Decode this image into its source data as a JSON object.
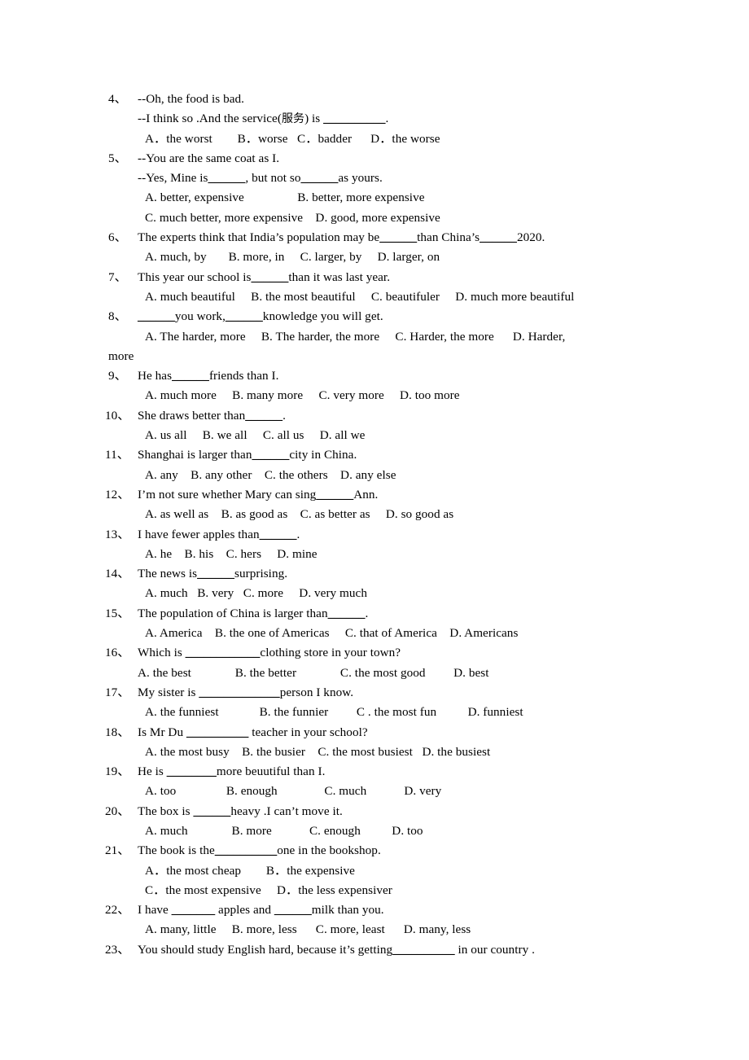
{
  "document": {
    "type": "worksheet",
    "subject": "English grammar multiple-choice exercise (comparatives and superlatives)",
    "background_color": "#ffffff",
    "text_color": "#000000",
    "number_separator": "、"
  },
  "questions": [
    {
      "number": "4",
      "stem": "--Oh, the food is bad.",
      "stem_lines": [
        {
          "segments": [
            {
              "text": "--I think so .And the service("
            },
            {
              "text": "服务",
              "style": "zh"
            },
            {
              "text": ") is "
            },
            {
              "text": "__________",
              "style": "blank"
            },
            {
              "text": "."
            }
          ]
        }
      ],
      "option_rows": [
        {
          "text": "A．the worst        B．worse   C．badder      D．the worse"
        }
      ]
    },
    {
      "number": "5",
      "stem": "--You are the same coat as I.",
      "stem_lines": [
        {
          "segments": [
            {
              "text": "--Yes, Mine is"
            },
            {
              "text": "______",
              "style": "blank"
            },
            {
              "text": ", but not so"
            },
            {
              "text": "______",
              "style": "blank"
            },
            {
              "text": "as yours."
            }
          ]
        }
      ],
      "option_rows": [
        {
          "text": "A. better, expensive                 B. better, more expensive"
        },
        {
          "text": "C. much better, more expensive    D. good, more expensive"
        }
      ]
    },
    {
      "number": "6",
      "stem_segments": [
        {
          "text": "The experts think that India’s population may be"
        },
        {
          "text": "______",
          "style": "blank"
        },
        {
          "text": "than China’s"
        },
        {
          "text": "______",
          "style": "blank"
        },
        {
          "text": "2020."
        }
      ],
      "option_rows": [
        {
          "text": "A. much, by       B. more, in     C. larger, by     D. larger, on"
        }
      ]
    },
    {
      "number": "7",
      "stem_segments": [
        {
          "text": "This year our school is"
        },
        {
          "text": "______",
          "style": "blank"
        },
        {
          "text": "than it was last year."
        }
      ],
      "option_rows": [
        {
          "text": "A. much beautiful     B. the most beautiful     C. beautifuler     D. much more beautiful"
        }
      ]
    },
    {
      "number": "8",
      "stem_segments": [
        {
          "text": "______",
          "style": "blank"
        },
        {
          "text": "you work,"
        },
        {
          "text": "______",
          "style": "blank"
        },
        {
          "text": "knowledge you will get."
        }
      ],
      "option_rows": [
        {
          "text": "A. The harder, more     B. The harder, the more     C. Harder, the more      D. Harder,"
        },
        {
          "text": "more",
          "wrap": true
        }
      ]
    },
    {
      "number": "9",
      "stem_segments": [
        {
          "text": "He has"
        },
        {
          "text": "______",
          "style": "blank"
        },
        {
          "text": "friends than I."
        }
      ],
      "option_rows": [
        {
          "text": "A. much more     B. many more     C. very more     D. too more"
        }
      ]
    },
    {
      "number": "10",
      "stem_segments": [
        {
          "text": "She draws better than"
        },
        {
          "text": "______",
          "style": "blank"
        },
        {
          "text": "."
        }
      ],
      "option_rows": [
        {
          "text": "A. us all     B. we all     C. all us     D. all we"
        }
      ]
    },
    {
      "number": "11",
      "stem_segments": [
        {
          "text": "Shanghai is larger than"
        },
        {
          "text": "______",
          "style": "blank"
        },
        {
          "text": "city in China."
        }
      ],
      "option_rows": [
        {
          "text": "A. any    B. any other    C. the others    D. any else"
        }
      ]
    },
    {
      "number": "12",
      "stem_segments": [
        {
          "text": "I’m not sure whether Mary can sing"
        },
        {
          "text": "______",
          "style": "blank"
        },
        {
          "text": "Ann."
        }
      ],
      "option_rows": [
        {
          "text": "A. as well as    B. as good as    C. as better as     D. so good as"
        }
      ]
    },
    {
      "number": "13",
      "stem_segments": [
        {
          "text": "I have fewer apples than"
        },
        {
          "text": "______",
          "style": "blank"
        },
        {
          "text": "."
        }
      ],
      "option_rows": [
        {
          "text": "A. he    B. his    C. hers     D. mine"
        }
      ]
    },
    {
      "number": "14",
      "stem_segments": [
        {
          "text": "The news is"
        },
        {
          "text": "______",
          "style": "blank"
        },
        {
          "text": "surprising."
        }
      ],
      "option_rows": [
        {
          "text": "A. much   B. very   C. more     D. very much"
        }
      ]
    },
    {
      "number": "15",
      "stem_segments": [
        {
          "text": "The population of China is larger than"
        },
        {
          "text": "______",
          "style": "blank"
        },
        {
          "text": "."
        }
      ],
      "option_rows": [
        {
          "text": "A. America    B. the one of Americas     C. that of America    D. Americans"
        }
      ]
    },
    {
      "number": "16",
      "stem_segments": [
        {
          "text": "Which is "
        },
        {
          "text": "____________",
          "style": "blank"
        },
        {
          "text": "clothing store in your town?"
        }
      ],
      "option_rows": [
        {
          "text": "A. the best              B. the better              C. the most good         D. best",
          "narrow": true
        }
      ]
    },
    {
      "number": "17",
      "stem_segments": [
        {
          "text": "My sister is "
        },
        {
          "text": "_____________",
          "style": "blank"
        },
        {
          "text": "person I know."
        }
      ],
      "option_rows": [
        {
          "text": "A. the funniest             B. the funnier         C . the most fun          D. funniest"
        }
      ]
    },
    {
      "number": "18",
      "stem_segments": [
        {
          "text": "Is Mr Du "
        },
        {
          "text": "__________",
          "style": "blank"
        },
        {
          "text": " teacher in your school?"
        }
      ],
      "option_rows": [
        {
          "text": "A. the most busy    B. the busier    C. the most busiest   D. the busiest"
        }
      ]
    },
    {
      "number": "19",
      "stem_segments": [
        {
          "text": "He is "
        },
        {
          "text": "________",
          "style": "blank"
        },
        {
          "text": "more beuutiful than I."
        }
      ],
      "option_rows": [
        {
          "text": "A. too                B. enough               C. much            D. very"
        }
      ]
    },
    {
      "number": "20",
      "stem_segments": [
        {
          "text": "The box is "
        },
        {
          "text": "______",
          "style": "blank"
        },
        {
          "text": "heavy .I can’t move it."
        }
      ],
      "option_rows": [
        {
          "text": "A. much              B. more            C. enough          D. too"
        }
      ]
    },
    {
      "number": "21",
      "stem_segments": [
        {
          "text": "The book is the"
        },
        {
          "text": "__________",
          "style": "blank"
        },
        {
          "text": "one in the bookshop."
        }
      ],
      "option_rows": [
        {
          "text": "A．the most cheap        B．the expensive"
        },
        {
          "text": "C．the most expensive     D．the less expensiver"
        }
      ]
    },
    {
      "number": "22",
      "stem_segments": [
        {
          "text": "I have "
        },
        {
          "text": "_______",
          "style": "blank"
        },
        {
          "text": " apples and "
        },
        {
          "text": "______",
          "style": "blank"
        },
        {
          "text": "milk than you."
        }
      ],
      "option_rows": [
        {
          "text": "A. many, little     B. more, less      C. more, least      D. many, less"
        }
      ]
    },
    {
      "number": "23",
      "stem_segments": [
        {
          "text": "You should study English hard, because it’s getting"
        },
        {
          "text": "__________",
          "style": "blank"
        },
        {
          "text": " in our country ."
        }
      ],
      "option_rows": []
    }
  ]
}
